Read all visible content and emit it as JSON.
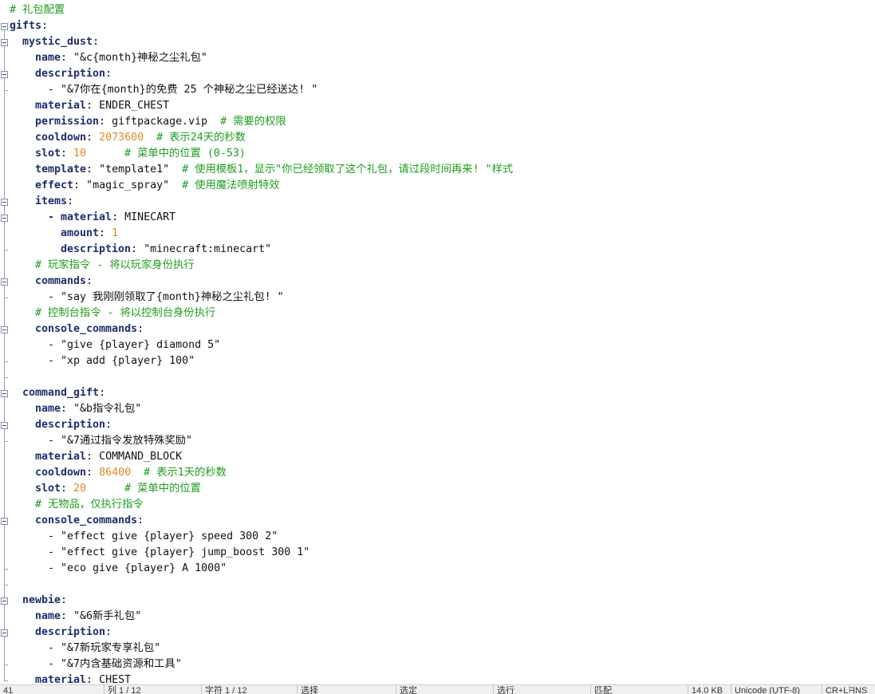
{
  "lines": [
    {
      "indent": 0,
      "parts": [
        {
          "t": "# 礼包配置",
          "c": "cm"
        }
      ]
    },
    {
      "indent": 0,
      "parts": [
        {
          "t": "gifts",
          "c": "key"
        },
        {
          "t": ":",
          "c": "p"
        }
      ]
    },
    {
      "indent": 2,
      "parts": [
        {
          "t": "mystic_dust",
          "c": "key"
        },
        {
          "t": ":",
          "c": "p"
        }
      ]
    },
    {
      "indent": 4,
      "parts": [
        {
          "t": "name",
          "c": "key"
        },
        {
          "t": ": ",
          "c": "p"
        },
        {
          "t": "\"&c{month}神秘之尘礼包\"",
          "c": "str"
        }
      ]
    },
    {
      "indent": 4,
      "parts": [
        {
          "t": "description",
          "c": "key"
        },
        {
          "t": ":",
          "c": "p"
        }
      ]
    },
    {
      "indent": 6,
      "parts": [
        {
          "t": "- ",
          "c": "p"
        },
        {
          "t": "\"&7你在{month}的免费 25 个神秘之尘已经送达! \"",
          "c": "str"
        }
      ]
    },
    {
      "indent": 4,
      "parts": [
        {
          "t": "material",
          "c": "key"
        },
        {
          "t": ": ",
          "c": "p"
        },
        {
          "t": "ENDER_CHEST",
          "c": "plain"
        }
      ]
    },
    {
      "indent": 4,
      "parts": [
        {
          "t": "permission",
          "c": "key"
        },
        {
          "t": ": ",
          "c": "p"
        },
        {
          "t": "giftpackage.vip  ",
          "c": "plain"
        },
        {
          "t": "# 需要的权限",
          "c": "cm"
        }
      ]
    },
    {
      "indent": 4,
      "parts": [
        {
          "t": "cooldown",
          "c": "key"
        },
        {
          "t": ": ",
          "c": "p"
        },
        {
          "t": "2073600",
          "c": "num"
        },
        {
          "t": "  ",
          "c": "p"
        },
        {
          "t": "# 表示24天的秒数",
          "c": "cm"
        }
      ]
    },
    {
      "indent": 4,
      "parts": [
        {
          "t": "slot",
          "c": "key"
        },
        {
          "t": ": ",
          "c": "p"
        },
        {
          "t": "10",
          "c": "num"
        },
        {
          "t": "      ",
          "c": "p"
        },
        {
          "t": "# 菜单中的位置 (0-53)",
          "c": "cm"
        }
      ]
    },
    {
      "indent": 4,
      "parts": [
        {
          "t": "template",
          "c": "key"
        },
        {
          "t": ": ",
          "c": "p"
        },
        {
          "t": "\"template1\"",
          "c": "str"
        },
        {
          "t": "  ",
          "c": "p"
        },
        {
          "t": "# 使用模板1，显示\"你已经领取了这个礼包，请过段时间再来! \"样式",
          "c": "cm"
        }
      ]
    },
    {
      "indent": 4,
      "parts": [
        {
          "t": "effect",
          "c": "key"
        },
        {
          "t": ": ",
          "c": "p"
        },
        {
          "t": "\"magic_spray\"",
          "c": "str"
        },
        {
          "t": "  ",
          "c": "p"
        },
        {
          "t": "# 使用魔法喷射特效",
          "c": "cm"
        }
      ]
    },
    {
      "indent": 4,
      "parts": [
        {
          "t": "items",
          "c": "key"
        },
        {
          "t": ":",
          "c": "p"
        }
      ]
    },
    {
      "indent": 6,
      "parts": [
        {
          "t": "- ",
          "c": "key"
        },
        {
          "t": "material",
          "c": "key"
        },
        {
          "t": ": ",
          "c": "p"
        },
        {
          "t": "MINECART",
          "c": "plain"
        }
      ]
    },
    {
      "indent": 8,
      "parts": [
        {
          "t": "amount",
          "c": "key"
        },
        {
          "t": ": ",
          "c": "p"
        },
        {
          "t": "1",
          "c": "num"
        }
      ]
    },
    {
      "indent": 8,
      "parts": [
        {
          "t": "description",
          "c": "key"
        },
        {
          "t": ": ",
          "c": "p"
        },
        {
          "t": "\"minecraft:minecart\"",
          "c": "str"
        }
      ]
    },
    {
      "indent": 4,
      "parts": [
        {
          "t": "# 玩家指令 - 将以玩家身份执行",
          "c": "cm"
        }
      ]
    },
    {
      "indent": 4,
      "parts": [
        {
          "t": "commands",
          "c": "key"
        },
        {
          "t": ":",
          "c": "p"
        }
      ]
    },
    {
      "indent": 6,
      "parts": [
        {
          "t": "- ",
          "c": "p"
        },
        {
          "t": "\"say 我刚刚领取了{month}神秘之尘礼包! \"",
          "c": "str"
        }
      ]
    },
    {
      "indent": 4,
      "parts": [
        {
          "t": "# 控制台指令 - 将以控制台身份执行",
          "c": "cm"
        }
      ]
    },
    {
      "indent": 4,
      "parts": [
        {
          "t": "console_commands",
          "c": "key"
        },
        {
          "t": ":",
          "c": "p"
        }
      ]
    },
    {
      "indent": 6,
      "parts": [
        {
          "t": "- ",
          "c": "p"
        },
        {
          "t": "\"give {player} diamond 5\"",
          "c": "str"
        }
      ]
    },
    {
      "indent": 6,
      "parts": [
        {
          "t": "- ",
          "c": "p"
        },
        {
          "t": "\"xp add {player} 100\"",
          "c": "str"
        }
      ]
    },
    {
      "indent": 0,
      "parts": []
    },
    {
      "indent": 2,
      "parts": [
        {
          "t": "command_gift",
          "c": "key"
        },
        {
          "t": ":",
          "c": "p"
        }
      ]
    },
    {
      "indent": 4,
      "parts": [
        {
          "t": "name",
          "c": "key"
        },
        {
          "t": ": ",
          "c": "p"
        },
        {
          "t": "\"&b指令礼包\"",
          "c": "str"
        }
      ]
    },
    {
      "indent": 4,
      "parts": [
        {
          "t": "description",
          "c": "key"
        },
        {
          "t": ":",
          "c": "p"
        }
      ]
    },
    {
      "indent": 6,
      "parts": [
        {
          "t": "- ",
          "c": "p"
        },
        {
          "t": "\"&7通过指令发放特殊奖励\"",
          "c": "str"
        }
      ]
    },
    {
      "indent": 4,
      "parts": [
        {
          "t": "material",
          "c": "key"
        },
        {
          "t": ": ",
          "c": "p"
        },
        {
          "t": "COMMAND_BLOCK",
          "c": "plain"
        }
      ]
    },
    {
      "indent": 4,
      "parts": [
        {
          "t": "cooldown",
          "c": "key"
        },
        {
          "t": ": ",
          "c": "p"
        },
        {
          "t": "86400",
          "c": "num"
        },
        {
          "t": "  ",
          "c": "p"
        },
        {
          "t": "# 表示1天的秒数",
          "c": "cm"
        }
      ]
    },
    {
      "indent": 4,
      "parts": [
        {
          "t": "slot",
          "c": "key"
        },
        {
          "t": ": ",
          "c": "p"
        },
        {
          "t": "20",
          "c": "num"
        },
        {
          "t": "      ",
          "c": "p"
        },
        {
          "t": "# 菜单中的位置",
          "c": "cm"
        }
      ]
    },
    {
      "indent": 4,
      "parts": [
        {
          "t": "# 无物品，仅执行指令",
          "c": "cm"
        }
      ]
    },
    {
      "indent": 4,
      "parts": [
        {
          "t": "console_commands",
          "c": "key"
        },
        {
          "t": ":",
          "c": "p"
        }
      ]
    },
    {
      "indent": 6,
      "parts": [
        {
          "t": "- ",
          "c": "p"
        },
        {
          "t": "\"effect give {player} speed 300 2\"",
          "c": "str"
        }
      ]
    },
    {
      "indent": 6,
      "parts": [
        {
          "t": "- ",
          "c": "p"
        },
        {
          "t": "\"effect give {player} jump_boost 300 1\"",
          "c": "str"
        }
      ]
    },
    {
      "indent": 6,
      "parts": [
        {
          "t": "- ",
          "c": "p"
        },
        {
          "t": "\"eco give {player} A 1000\"",
          "c": "str"
        }
      ]
    },
    {
      "indent": 0,
      "parts": []
    },
    {
      "indent": 2,
      "parts": [
        {
          "t": "newbie",
          "c": "key"
        },
        {
          "t": ":",
          "c": "p"
        }
      ]
    },
    {
      "indent": 4,
      "parts": [
        {
          "t": "name",
          "c": "key"
        },
        {
          "t": ": ",
          "c": "p"
        },
        {
          "t": "\"&6新手礼包\"",
          "c": "str"
        }
      ]
    },
    {
      "indent": 4,
      "parts": [
        {
          "t": "description",
          "c": "key"
        },
        {
          "t": ":",
          "c": "p"
        }
      ]
    },
    {
      "indent": 6,
      "parts": [
        {
          "t": "- ",
          "c": "p"
        },
        {
          "t": "\"&7新玩家专享礼包\"",
          "c": "str"
        }
      ]
    },
    {
      "indent": 6,
      "parts": [
        {
          "t": "- ",
          "c": "p"
        },
        {
          "t": "\"&7内含基础资源和工具\"",
          "c": "str"
        }
      ]
    },
    {
      "indent": 4,
      "parts": [
        {
          "t": "material",
          "c": "key"
        },
        {
          "t": ": ",
          "c": "p"
        },
        {
          "t": "CHEST",
          "c": "plain"
        }
      ]
    }
  ],
  "folds": [
    {
      "start": 1,
      "end": 42
    },
    {
      "start": 2,
      "end": 23
    },
    {
      "start": 4,
      "end": 5
    },
    {
      "start": 12,
      "end": 15
    },
    {
      "start": 13,
      "end": 15
    },
    {
      "start": 17,
      "end": 18
    },
    {
      "start": 20,
      "end": 22
    },
    {
      "start": 24,
      "end": 36
    },
    {
      "start": 26,
      "end": 27
    },
    {
      "start": 32,
      "end": 35
    },
    {
      "start": 37,
      "end": 42
    },
    {
      "start": 39,
      "end": 41
    }
  ],
  "colors": {
    "key": "#1e2d6b",
    "number": "#e08a1e",
    "comment": "#1f9d1f",
    "text": "#111111",
    "gutter_line": "#9aa3b5"
  },
  "statusbar": {
    "items": [
      "41",
      "列 1 / 12",
      "字符 1 / 12",
      "选择",
      "选定",
      "选行",
      "匹配",
      "14.0 KB",
      "Unicode (UTF-8)",
      "CR+LF",
      "INS"
    ]
  }
}
